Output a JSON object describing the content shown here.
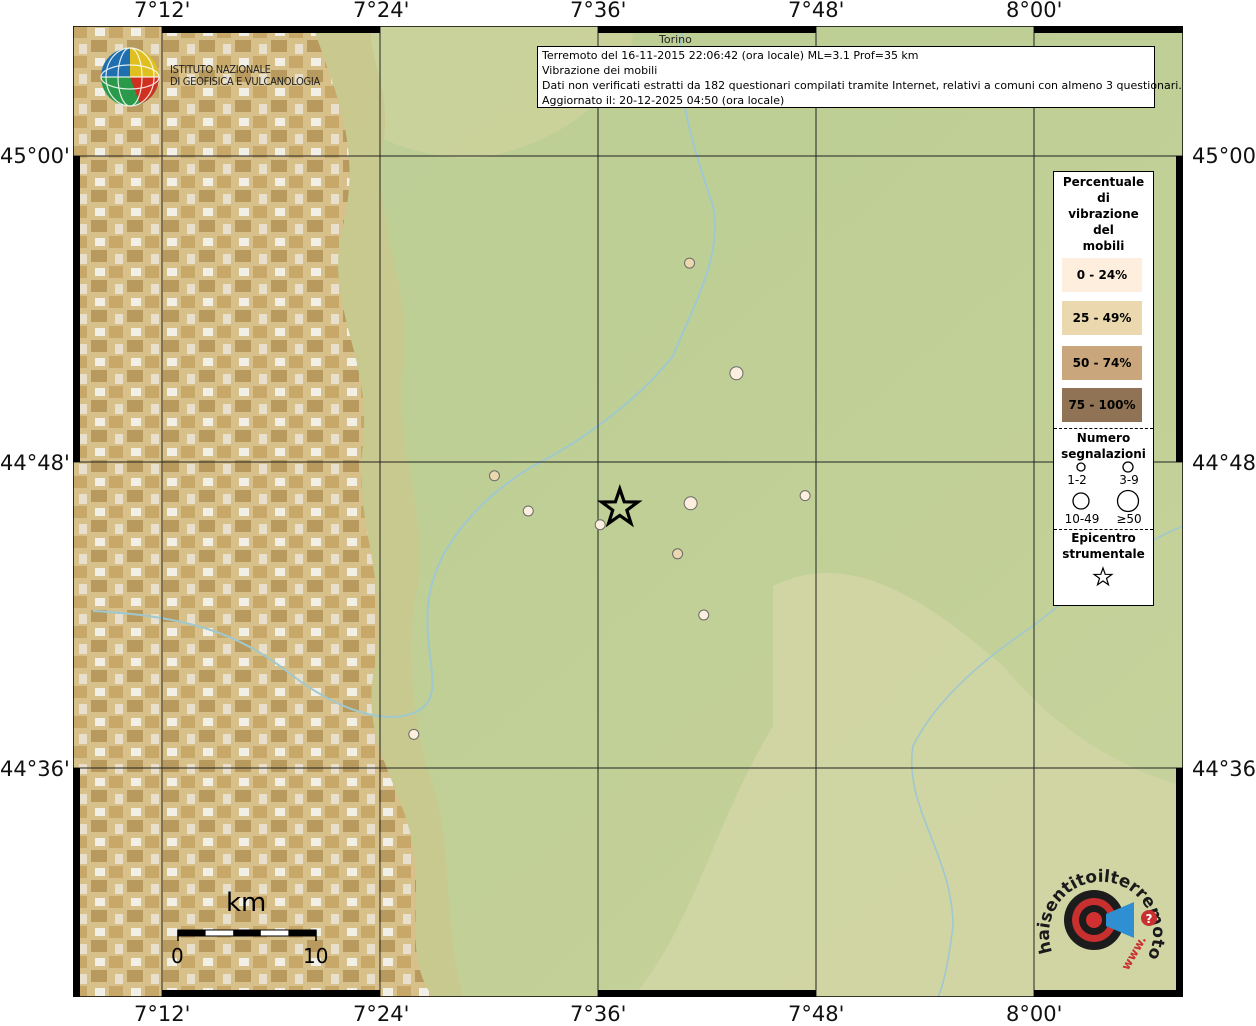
{
  "header": {
    "line1": "Terremoto del 16-11-2015 22:06:42 (ora locale) ML=3.1 Prof=35 km",
    "line2": "Vibrazione dei mobili",
    "line3": "Dati non verificati estratti da 182 questionari compilati tramite Internet, relativi a comuni con almeno 3 questionari.",
    "line4": "Aggiornato il: 20-12-2025 04:50 (ora locale)"
  },
  "axes": {
    "lon_labels": [
      "7°12'",
      "7°24'",
      "7°36'",
      "7°48'",
      "8°00'"
    ],
    "lat_labels": [
      "45°00'",
      "44°48'",
      "44°36'"
    ]
  },
  "place_label": "Torino",
  "ingv": {
    "line1": "ISTITUTO NAZIONALE",
    "line2": "DI GEOFISICA E VULCANOLOGIA"
  },
  "legend": {
    "percent_title": [
      "Percentuale",
      "di",
      "vibrazione",
      "del",
      "mobili"
    ],
    "classes": [
      {
        "label": "0 - 24%",
        "color": "#fdeedd"
      },
      {
        "label": "25 - 49%",
        "color": "#ecd8ae"
      },
      {
        "label": "50 - 74%",
        "color": "#c9a67c"
      },
      {
        "label": "75 - 100%",
        "color": "#8f7354"
      }
    ],
    "count_title": [
      "Numero",
      "segnalazioni"
    ],
    "counts": [
      "1-2",
      "3-9",
      "10-49",
      "≥50"
    ],
    "epi_title": [
      "Epicentro",
      "strumentale"
    ]
  },
  "scale": {
    "unit": "km",
    "min": "0",
    "max": "10"
  },
  "hst_logo": {
    "text": "haisentitoilterremoto.it",
    "www": "www."
  },
  "epicenter": {
    "lon": 7.62,
    "lat": 44.77
  },
  "observations": [
    {
      "lon": 7.684,
      "lat": 44.93,
      "class": "25 - 49%",
      "size": "3-9"
    },
    {
      "lon": 7.727,
      "lat": 44.858,
      "class": "0 - 24%",
      "size": "10-49"
    },
    {
      "lon": 7.505,
      "lat": 44.791,
      "class": "25 - 49%",
      "size": "3-9"
    },
    {
      "lon": 7.536,
      "lat": 44.768,
      "class": "0 - 24%",
      "size": "3-9"
    },
    {
      "lon": 7.602,
      "lat": 44.759,
      "class": "0 - 24%",
      "size": "3-9"
    },
    {
      "lon": 7.685,
      "lat": 44.773,
      "class": "0 - 24%",
      "size": "10-49"
    },
    {
      "lon": 7.79,
      "lat": 44.778,
      "class": "0 - 24%",
      "size": "3-9"
    },
    {
      "lon": 7.673,
      "lat": 44.74,
      "class": "25 - 49%",
      "size": "3-9"
    },
    {
      "lon": 7.697,
      "lat": 44.7,
      "class": "0 - 24%",
      "size": "3-9"
    },
    {
      "lon": 7.431,
      "lat": 44.622,
      "class": "0 - 24%",
      "size": "3-9"
    }
  ]
}
